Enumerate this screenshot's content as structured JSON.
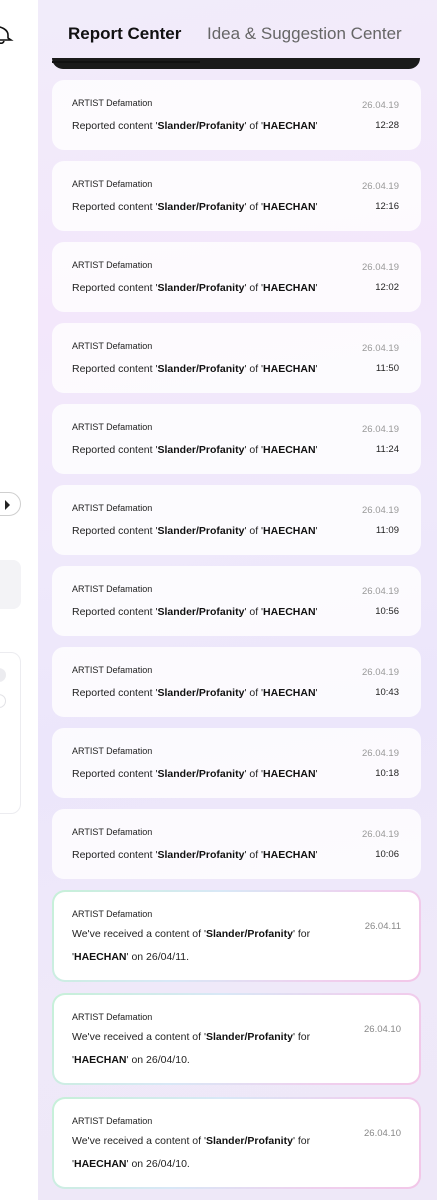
{
  "tabs": {
    "report_center": "Report Center",
    "idea_center": "Idea & Suggestion Center"
  },
  "reports": [
    {
      "category": "ARTIST Defamation",
      "prefix": "Reported content '",
      "content": "Slander/Profanity",
      "middle": "' of '",
      "artist": "HAECHAN",
      "suffix": "'",
      "date": "26.04.19",
      "time": "12:28"
    },
    {
      "category": "ARTIST Defamation",
      "prefix": "Reported content '",
      "content": "Slander/Profanity",
      "middle": "' of '",
      "artist": "HAECHAN",
      "suffix": "'",
      "date": "26.04.19",
      "time": "12:16"
    },
    {
      "category": "ARTIST Defamation",
      "prefix": "Reported content '",
      "content": "Slander/Profanity",
      "middle": "' of '",
      "artist": "HAECHAN",
      "suffix": "'",
      "date": "26.04.19",
      "time": "12:02"
    },
    {
      "category": "ARTIST Defamation",
      "prefix": "Reported content '",
      "content": "Slander/Profanity",
      "middle": "' of '",
      "artist": "HAECHAN",
      "suffix": "'",
      "date": "26.04.19",
      "time": "11:50"
    },
    {
      "category": "ARTIST Defamation",
      "prefix": "Reported content '",
      "content": "Slander/Profanity",
      "middle": "' of '",
      "artist": "HAECHAN",
      "suffix": "'",
      "date": "26.04.19",
      "time": "11:24"
    },
    {
      "category": "ARTIST Defamation",
      "prefix": "Reported content '",
      "content": "Slander/Profanity",
      "middle": "' of '",
      "artist": "HAECHAN",
      "suffix": "'",
      "date": "26.04.19",
      "time": "11:09"
    },
    {
      "category": "ARTIST Defamation",
      "prefix": "Reported content '",
      "content": "Slander/Profanity",
      "middle": "' of '",
      "artist": "HAECHAN",
      "suffix": "'",
      "date": "26.04.19",
      "time": "10:56"
    },
    {
      "category": "ARTIST Defamation",
      "prefix": "Reported content '",
      "content": "Slander/Profanity",
      "middle": "' of '",
      "artist": "HAECHAN",
      "suffix": "'",
      "date": "26.04.19",
      "time": "10:43"
    },
    {
      "category": "ARTIST Defamation",
      "prefix": "Reported content '",
      "content": "Slander/Profanity",
      "middle": "' of '",
      "artist": "HAECHAN",
      "suffix": "'",
      "date": "26.04.19",
      "time": "10:18"
    },
    {
      "category": "ARTIST Defamation",
      "prefix": "Reported content '",
      "content": "Slander/Profanity",
      "middle": "' of '",
      "artist": "HAECHAN",
      "suffix": "'",
      "date": "26.04.19",
      "time": "10:06"
    }
  ],
  "received": [
    {
      "category": "ARTIST Defamation",
      "prefix": "We've received a content of '",
      "content": "Slander/Profanity",
      "middle": "' for",
      "q1": "'",
      "artist": "HAECHAN",
      "tail": "' on 26/04/11.",
      "date": "26.04.11"
    },
    {
      "category": "ARTIST Defamation",
      "prefix": "We've received a content of '",
      "content": "Slander/Profanity",
      "middle": "' for",
      "q1": "'",
      "artist": "HAECHAN",
      "tail": "' on 26/04/10.",
      "date": "26.04.10"
    },
    {
      "category": "ARTIST Defamation",
      "prefix": "We've received a content of '",
      "content": "Slander/Profanity",
      "middle": "' for",
      "q1": "'",
      "artist": "HAECHAN",
      "tail": "' on 26/04/10.",
      "date": "26.04.10"
    }
  ],
  "icons": {
    "bell": "bell-icon",
    "play": "play-icon"
  },
  "colors": {
    "tab_active": "#111111",
    "tab_inactive": "#666666",
    "date_text": "#999999",
    "gradient_border_start": "#c6f0d8",
    "gradient_border_end": "#f2c6e8"
  }
}
